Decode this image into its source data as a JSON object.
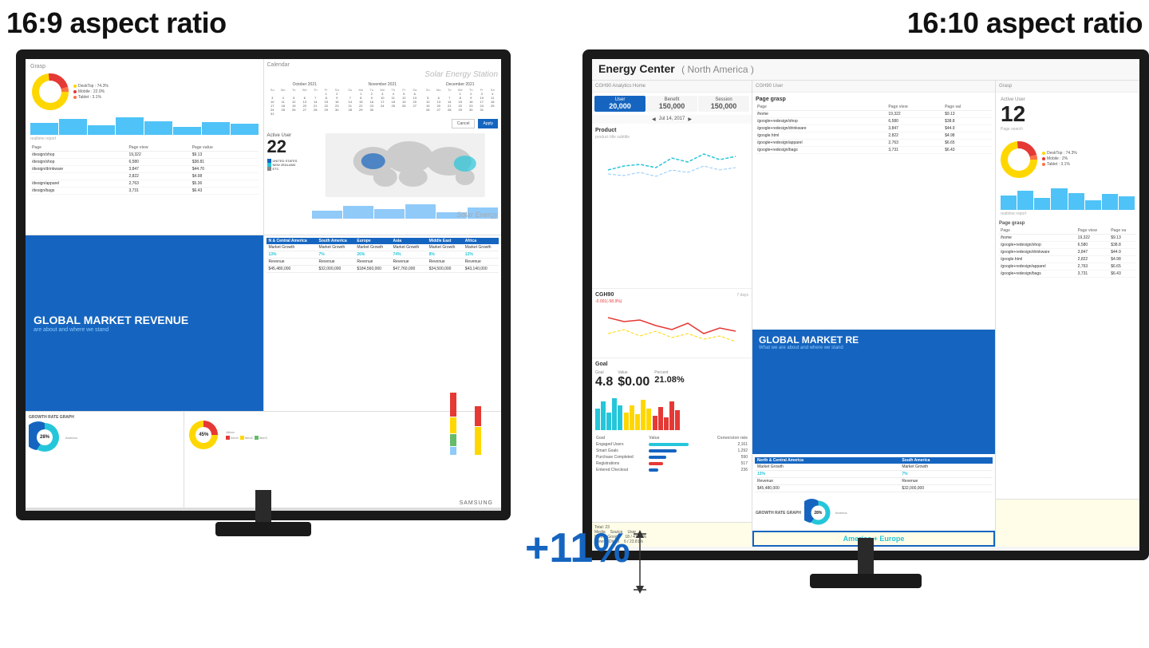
{
  "left_monitor": {
    "label": "16:9 aspect ratio",
    "grasp_title": "Grasp",
    "calendar_title": "Calendar",
    "solar_station": "Solar Energy Station",
    "solar_energy": "Solar Energy",
    "active_user": "Active User",
    "active_user_num": "22",
    "countries": [
      "UNITED STATES",
      "NEW ZEALAND",
      "ETC"
    ],
    "donut_legend": [
      {
        "label": "DeskTop : 74.3%",
        "color": "#ffd700"
      },
      {
        "label": "Mobile : 22.0%",
        "color": "#e53935"
      },
      {
        "label": "Tablet : 3.1%",
        "color": "#ff7043"
      }
    ],
    "realtime_report": "realtime report",
    "page_table_headers": [
      "Page",
      "Page view",
      "Page value"
    ],
    "page_table_rows": [
      [
        "/design/shop",
        "19,322",
        "$9.13"
      ],
      [
        "/design/shop",
        "6,580",
        "$38.81"
      ],
      [
        "/design/drinkware",
        "3,847",
        "$44.70"
      ],
      [
        "",
        "2,822",
        "$4.98"
      ],
      [
        "/design/apparel",
        "2,763",
        "$5.36"
      ],
      [
        "/design/bags",
        "3,731",
        "$6.43"
      ]
    ],
    "global_banner_title": "GLOBAL MARKET REVENUE",
    "global_banner_sub": "are about and where we stand",
    "regions": [
      "N & Central America",
      "South America",
      "Europe",
      "Asia",
      "Middle East",
      "Africa"
    ],
    "market_growth": [
      "13%",
      "7%",
      "26%",
      "74%",
      "8%",
      "12%"
    ],
    "revenues": [
      "$45,480,000",
      "$32,000,000",
      "$184,560,000",
      "$47,760,000",
      "$34,500,000",
      "$43,140,000"
    ],
    "growth_rate_title": "GROWTH RATE GRAPH",
    "pie_28": "28%",
    "pie_45": "45%",
    "samsung_logo": "SAMSUNG"
  },
  "right_monitor": {
    "label": "16:10 aspect ratio",
    "energy_center_title": "Energy Center",
    "energy_center_sub": "( North America )",
    "analytics_home": "CGH90 Analytics Home",
    "cgh90_user": "CGH90 User",
    "grasp_right": "Grasp",
    "user_tab": {
      "label": "User",
      "value": "20,000"
    },
    "benefit_tab": {
      "label": "Benefit",
      "value": "150,000"
    },
    "session_tab": {
      "label": "Session",
      "value": "150,000"
    },
    "active_user_right": "Active User",
    "active_user_num_right": "12",
    "page_search": "Page search",
    "date_label": "Jul 14, 2017",
    "product_title": "Product",
    "cgh90_title": "CGH90",
    "days_label": "7 days",
    "page_grasp": "Page grasp",
    "page_table_right_headers": [
      "Page",
      "Page view",
      "Page va"
    ],
    "page_table_right_rows": [
      [
        "/home",
        "19,322",
        "$9.13"
      ],
      [
        "/google+redesign/shop",
        "6,580",
        "$38.8"
      ],
      [
        "/google+redesign/drinkware",
        "3,847",
        "$44.9"
      ],
      [
        "/google.html",
        "2,822",
        "$4.98"
      ],
      [
        "/google+redesign/apparel",
        "2,763",
        "$6.65"
      ],
      [
        "/google+redesign/bags",
        "3,731",
        "$6.43"
      ]
    ],
    "goal_section": "Goal",
    "goal_label": "Goal",
    "value_label": "Value",
    "percent_label": "Percent",
    "goal_value": "4.8",
    "value_value": "$0.00",
    "percent_value": "21.08%",
    "goal_table_rows": [
      {
        "label": "Engaged Users",
        "value": "2,161",
        "color": "#26c6da"
      },
      {
        "label": "Smart Goals",
        "value": "1,292",
        "color": "#1565c0"
      },
      {
        "label": "Purchase Completed",
        "value": "590",
        "color": "#1565c0"
      },
      {
        "label": "Registrations",
        "value": "517",
        "color": "#e53935"
      },
      {
        "label": "Entered Checkout",
        "value": "236",
        "color": "#1565c0"
      }
    ],
    "global_banner_right": "GLOBAL MARKET RE",
    "global_banner_right_sub": "What we are about and where we stand",
    "regions_right": [
      "North & Central America",
      "South America"
    ],
    "market_growth_right": [
      "13%",
      "7%"
    ],
    "revenues_right": [
      "$45,480,000",
      "$32,000,000"
    ],
    "growth_rate_right": "GROWTH RATE GRAPH",
    "pie_28_right": "28%",
    "america_europe": "America + Europe",
    "bottom_total": "Total: 23",
    "bottom_source": "Source",
    "bottom_user": "User",
    "media_label": "Media",
    "free_label": "Free",
    "none_label": "None",
    "google_label": "Google",
    "direct_label": "Direct",
    "pct1": "18 / 41.62%",
    "pct2": "6 / 23.81%",
    "plus11": "+11%"
  },
  "colors": {
    "blue": "#1565c0",
    "cyan": "#26c6da",
    "red": "#e53935",
    "teal": "#00897b",
    "yellow": "#ffd700",
    "orange": "#ff7043",
    "light_blue": "#4fc3f7",
    "green": "#66bb6a"
  }
}
